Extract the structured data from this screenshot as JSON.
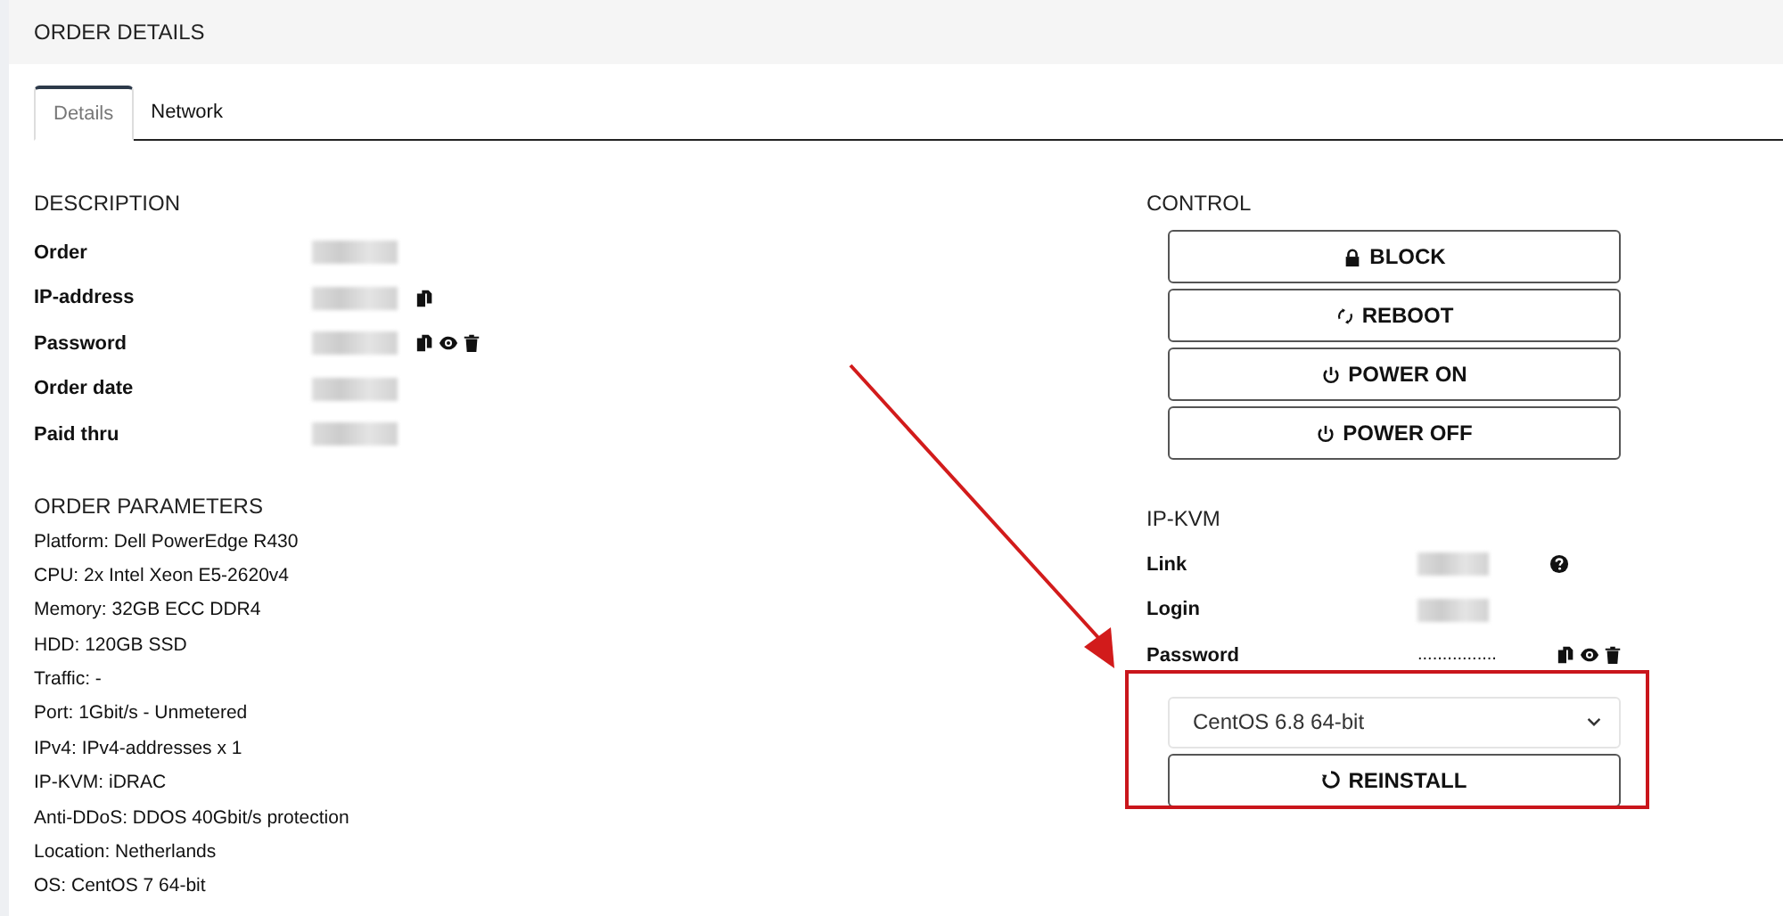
{
  "header": {
    "title": "ORDER DETAILS"
  },
  "tabs": [
    {
      "label": "Details",
      "selected": true
    },
    {
      "label": "Network",
      "selected": false
    }
  ],
  "description": {
    "title": "DESCRIPTION",
    "rows": [
      {
        "label": "Order",
        "redacted": true,
        "kind": "plain"
      },
      {
        "label": "IP-address",
        "redacted": true,
        "kind": "copyable"
      },
      {
        "label": "Password",
        "redacted": true,
        "kind": "secret"
      },
      {
        "label": "Order date",
        "redacted": true,
        "kind": "plain"
      },
      {
        "label": "Paid thru",
        "redacted": true,
        "kind": "plain"
      }
    ]
  },
  "parameters": {
    "title": "ORDER PARAMETERS",
    "items": [
      "Platform: Dell PowerEdge R430",
      "CPU: 2x Intel Xeon E5-2620v4",
      "Memory: 32GB ECC DDR4",
      "HDD: 120GB SSD",
      "Traffic: -",
      "Port: 1Gbit/s - Unmetered",
      "IPv4: IPv4-addresses x 1",
      "IP-KVM: iDRAC",
      "Anti-DDoS: DDOS 40Gbit/s protection",
      "Location: Netherlands",
      "OS: CentOS 7 64-bit"
    ]
  },
  "control": {
    "title": "CONTROL",
    "buttons": [
      "BLOCK",
      "REBOOT",
      "POWER ON",
      "POWER OFF"
    ]
  },
  "ipkvm": {
    "title": "IP-KVM",
    "rows": [
      {
        "label": "Link",
        "redacted": true,
        "kind": "link"
      },
      {
        "label": "Login",
        "redacted": true,
        "kind": "plain"
      },
      {
        "label": "Password",
        "value": "................",
        "kind": "secret"
      }
    ]
  },
  "reinstall": {
    "os_select": "CentOS 6.8 64-bit",
    "button": "REINSTALL"
  },
  "annotation": {
    "kind": "arrow-and-box"
  }
}
